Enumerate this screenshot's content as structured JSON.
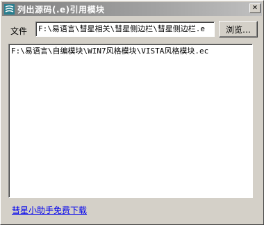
{
  "window": {
    "title": "列出源码(.e)引用模块",
    "close_label": "✕"
  },
  "form": {
    "file_label": "文件",
    "file_path": "F:\\易语言\\彗星相关\\彗星侧边栏\\彗星侧边栏.e",
    "browse_label": "浏览…"
  },
  "results": {
    "items": [
      "F:\\易语言\\自编模块\\WIN7风格模块\\VISTA风格模块.ec"
    ]
  },
  "footer": {
    "link_label": "彗星小助手免费下载"
  }
}
